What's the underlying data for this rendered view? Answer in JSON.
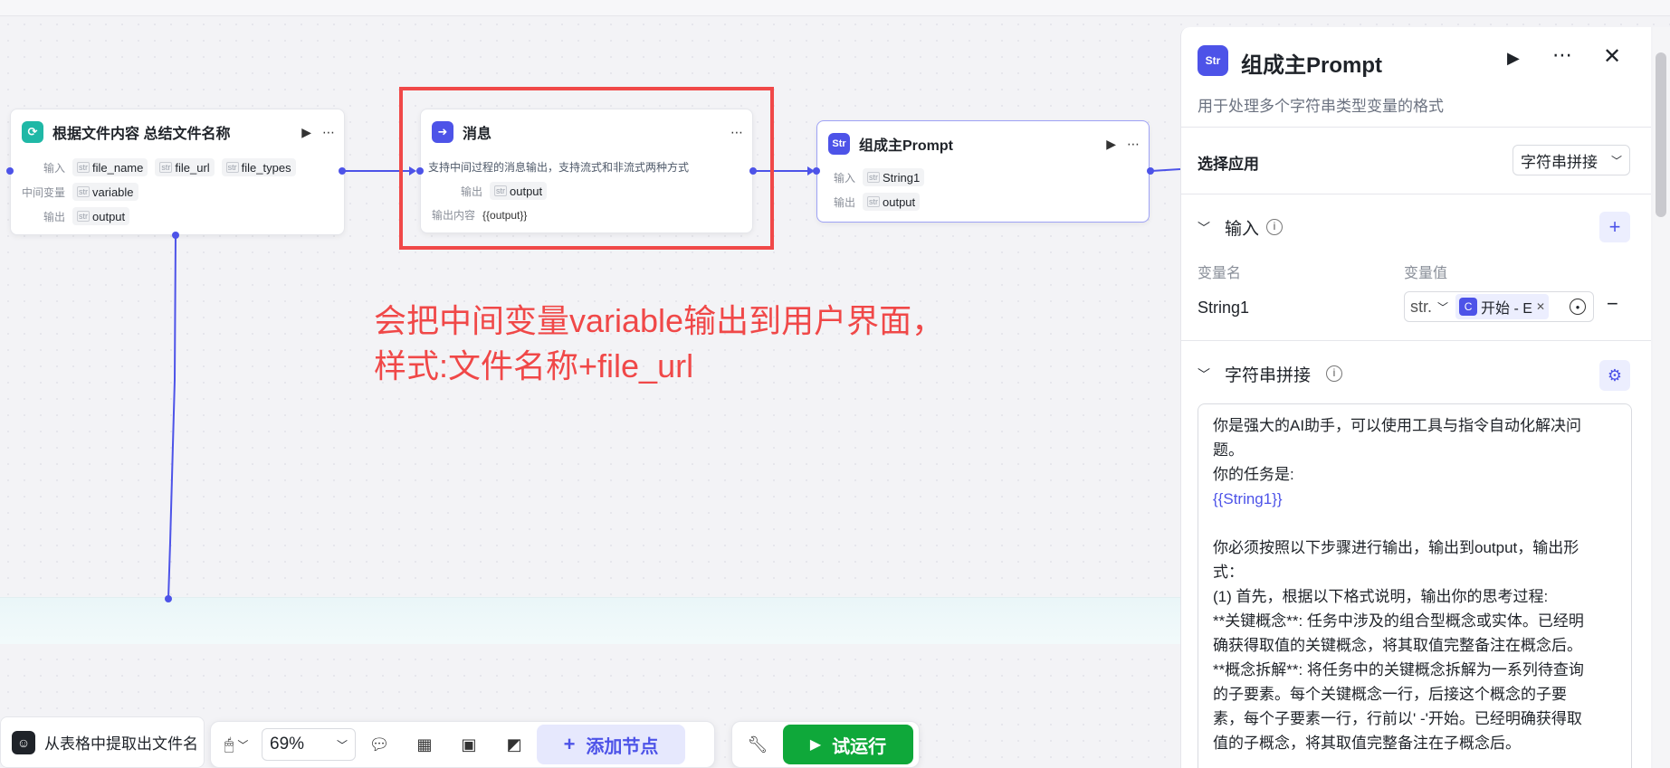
{
  "nodes": {
    "summarize": {
      "title": "根据文件内容 总结文件名称",
      "input_label": "输入",
      "inputs": [
        "file_name",
        "file_url",
        "file_types"
      ],
      "mid_label": "中间变量",
      "mid": "variable",
      "output_label": "输出",
      "output": "output"
    },
    "message": {
      "title": "消息",
      "description": "支持中间过程的消息输出，支持流式和非流式两种方式",
      "output_label": "输出",
      "output": "output",
      "content_label": "输出内容",
      "content": "{{output}}"
    },
    "prompt": {
      "title": "组成主Prompt",
      "input_label": "输入",
      "input": "String1",
      "output_label": "输出",
      "output": "output"
    }
  },
  "annotation": {
    "line1": "会把中间变量variable输出到用户界面，",
    "line2": "样式:文件名称+file_url"
  },
  "panel": {
    "title": "组成主Prompt",
    "subtitle": "用于处理多个字符串类型变量的格式",
    "select_app_label": "选择应用",
    "select_app_value": "字符串拼接",
    "input_section": "输入",
    "col_name": "变量名",
    "col_value": "变量值",
    "var_name": "String1",
    "var_type": "str.",
    "var_ref": "开始 - E",
    "concat_section": "字符串拼接",
    "text": {
      "l1": "你是强大的AI助手，可以使用工具与指令自动化解决问",
      "l2": "题。",
      "l3": "你的任务是:",
      "l4": "{{String1}}",
      "l5": "你必须按照以下步骤进行输出，输出到output，输出形",
      "l6": "式：",
      "l7": "(1) 首先，根据以下格式说明，输出你的思考过程:",
      "l8": "**关键概念**: 任务中涉及的组合型概念或实体。已经明",
      "l9": "确获得取值的关键概念，将其取值完整备注在概念后。",
      "l10": "**概念拆解**: 将任务中的关键概念拆解为一系列待查询",
      "l11": "的子要素。每个关键概念一行，后接这个概念的子要",
      "l12": "素，每个子要素一行，行前以' -'开始。已经明确获得取",
      "l13": "值的子概念，将其取值完整备注在子概念后。"
    }
  },
  "bottom": {
    "node_title": "从表格中提取出文件名",
    "zoom": "69%",
    "add_node": "添加节点",
    "test_run": "试运行"
  },
  "colors": {
    "accent": "#4d53e8",
    "annotation_red": "#f04848",
    "run_green": "#0fa83a",
    "teal": "#1fb8a6"
  }
}
